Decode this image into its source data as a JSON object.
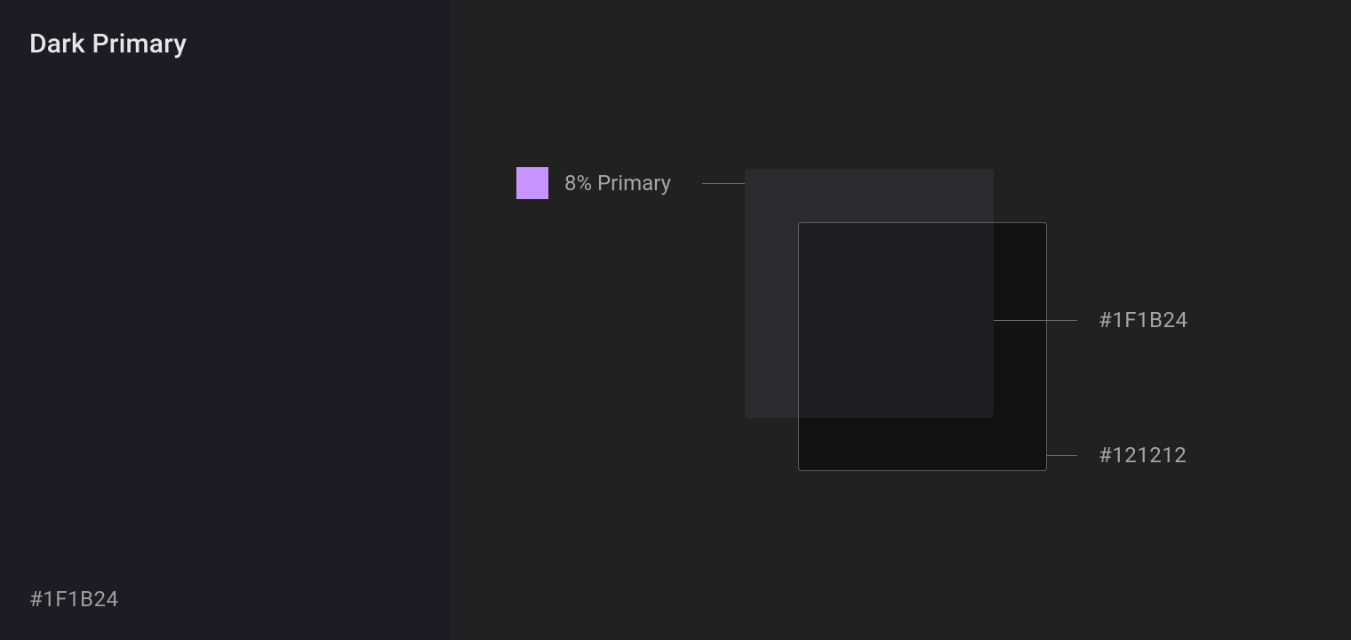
{
  "panel": {
    "title": "Dark Primary",
    "hex": "#1F1B24",
    "bg": "#1F1B24"
  },
  "legend": {
    "label": "8% Primary",
    "chipColor": "#C893FD"
  },
  "annotations": {
    "blendHex": "#1F1B24",
    "baseHex": "#121212"
  },
  "colors": {
    "baseSquare": "#121212",
    "overlaySquare": "rgba(200,147,253,0.08)",
    "pageBg": "#212121"
  }
}
